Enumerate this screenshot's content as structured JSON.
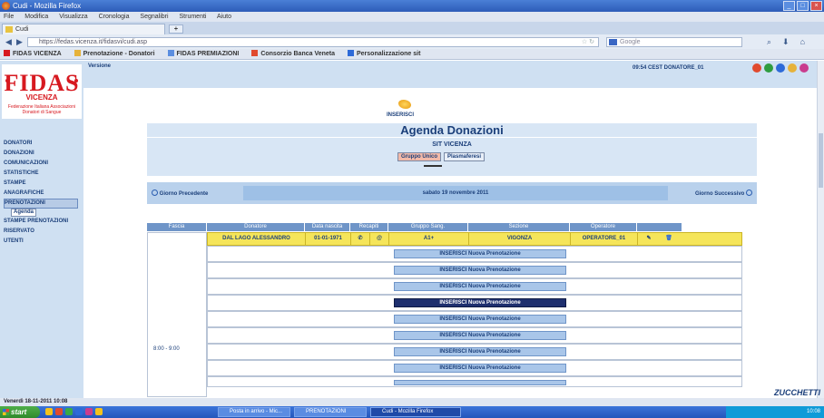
{
  "browser": {
    "title": "Cudi - Mozilla Firefox",
    "menu": [
      "File",
      "Modifica",
      "Visualizza",
      "Cronologia",
      "Segnalibri",
      "Strumenti",
      "Aiuto"
    ],
    "tab_label": "Cudi",
    "new_tab": "+",
    "url": "https://fedas.vicenza.it/fidasvi/cudi.asp",
    "search_placeholder": "Google",
    "bookmarks": [
      "FIDAS VICENZA",
      "Prenotazione - Donatori",
      "FIDAS PREMIAZIONI",
      "Consorzio Banca Veneta",
      "Personalizzazione sit"
    ]
  },
  "app": {
    "logo_text": "FIDAS",
    "logo_sub": "VICENZA",
    "logo_caption": "Federazione Italiana Associazioni Donatori di Sangue",
    "version": "Versione",
    "user_info": "09:54 CEST   DONATORE_01",
    "menu": [
      "DONATORI",
      "DONAZIONI",
      "COMUNICAZIONI",
      "STATISTICHE",
      "STAMPE",
      "ANAGRAFICHE",
      "PRENOTAZIONI",
      "STAMPE PRENOTAZIONI",
      "RISERVATO",
      "UTENTI"
    ],
    "submenu_label": "Agenda",
    "inserisci_label": "INSERISCI",
    "page_title": "Agenda Donazioni",
    "sit_name": "SIT VICENZA",
    "sit_btn_1": "Gruppo Unico",
    "sit_btn_2": "Plasmaferesi",
    "prev_day": "Giorno Precedente",
    "next_day": "Giorno Successivo",
    "current_date": "sabato 19 novembre 2011",
    "grid_headers": [
      "Fascia",
      "Donatore",
      "Data nascita",
      "Recapiti",
      "Gruppo Sang.",
      "Sezione",
      "Operatore",
      ""
    ],
    "donation": {
      "donor": "DAL LAGO ALESSANDRO",
      "birth": "01-01-1971",
      "blood_group": "A1+",
      "section": "VIGONZA",
      "operator": "OPERATORE_01"
    },
    "fascia_time": "8:00 - 9:00",
    "slot_button": "INSERISCI Nuova Prenotazione",
    "status_text": "Venerdì 18-11-2011 10:08",
    "brand": "ZUCCHETTI"
  },
  "taskbar": {
    "start": "start",
    "tasks": [
      "Posta in arrivo - Mic...",
      "PRENOTAZIONI",
      "Cudi - Mozilla Firefox"
    ],
    "clock": "10:08"
  },
  "colors": {
    "accent": "#1b3f7a",
    "brand_red": "#d71920",
    "highlight_row": "#f5e55a"
  }
}
